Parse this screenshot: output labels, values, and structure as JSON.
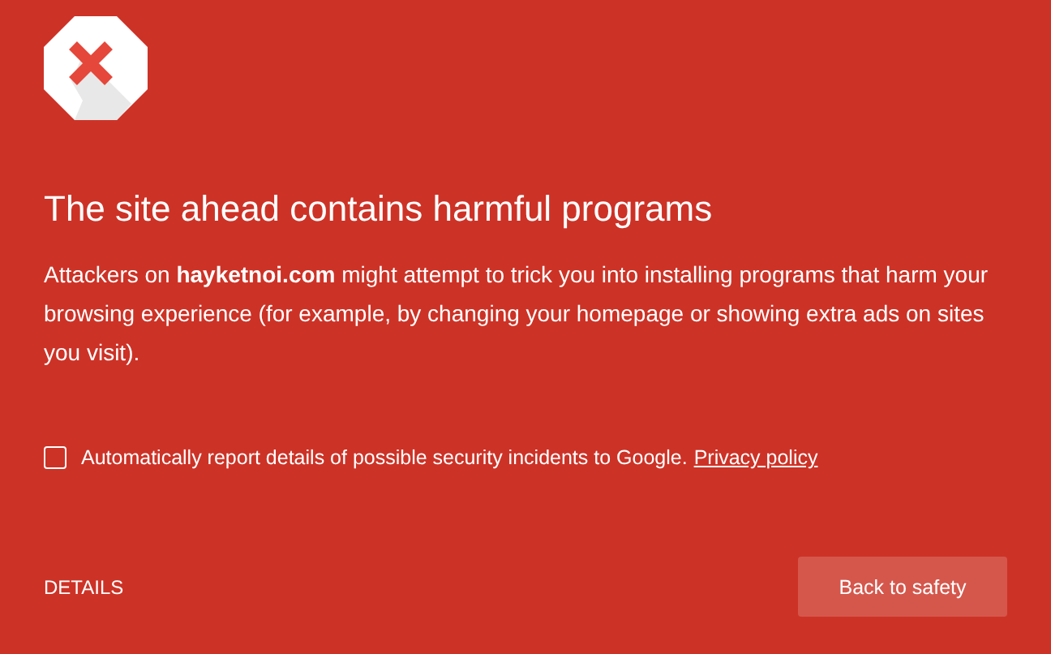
{
  "heading": "The site ahead contains harmful programs",
  "message": "Attackers on **hayketnoi.com** might attempt to trick you into installing programs that harm your browsing experience (for example, by changing your homepage or showing extra ads on sites you visit).",
  "report": {
    "label": "Automatically report details of possible security incidents to Google.",
    "link": "Privacy policy",
    "checked": false
  },
  "details_link": "DETAILS",
  "primary_button": "Back to safety"
}
